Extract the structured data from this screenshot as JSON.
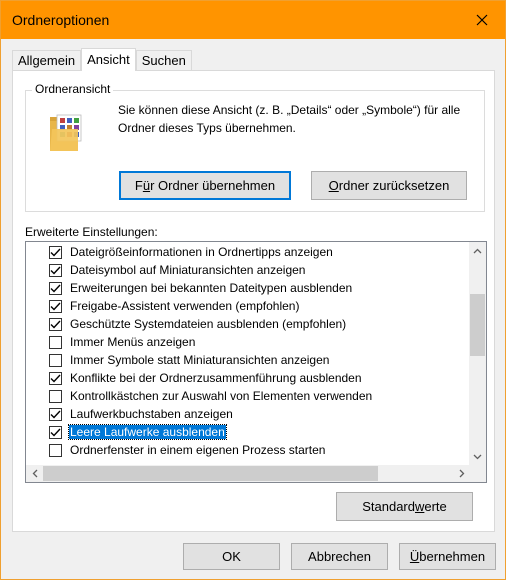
{
  "window": {
    "title": "Ordneroptionen"
  },
  "tabs": [
    {
      "label": "Allgemein",
      "active": false
    },
    {
      "label": "Ansicht",
      "active": true
    },
    {
      "label": "Suchen",
      "active": false
    }
  ],
  "folder_view": {
    "legend": "Ordneransicht",
    "description": "Sie können diese Ansicht (z. B. „Details“ oder „Symbole“) für alle Ordner dieses Typs übernehmen.",
    "apply_button": {
      "pre": "F",
      "key": "ü",
      "post": "r Ordner übernehmen"
    },
    "reset_button": {
      "pre": "",
      "key": "O",
      "post": "rdner zurücksetzen"
    }
  },
  "advanced": {
    "label": "Erweiterte Einstellungen:",
    "items": [
      {
        "label": "Dateigrößeinformationen in Ordnertipps anzeigen",
        "checked": true,
        "selected": false
      },
      {
        "label": "Dateisymbol auf Miniaturansichten anzeigen",
        "checked": true,
        "selected": false
      },
      {
        "label": "Erweiterungen bei bekannten Dateitypen ausblenden",
        "checked": true,
        "selected": false
      },
      {
        "label": "Freigabe-Assistent verwenden (empfohlen)",
        "checked": true,
        "selected": false
      },
      {
        "label": "Geschützte Systemdateien ausblenden (empfohlen)",
        "checked": true,
        "selected": false
      },
      {
        "label": "Immer Menüs anzeigen",
        "checked": false,
        "selected": false
      },
      {
        "label": "Immer Symbole statt Miniaturansichten anzeigen",
        "checked": false,
        "selected": false
      },
      {
        "label": "Konflikte bei der Ordnerzusammenführung ausblenden",
        "checked": true,
        "selected": false
      },
      {
        "label": "Kontrollkästchen zur Auswahl von Elementen verwenden",
        "checked": false,
        "selected": false
      },
      {
        "label": "Laufwerkbuchstaben anzeigen",
        "checked": true,
        "selected": false
      },
      {
        "label": "Leere Laufwerke ausblenden",
        "checked": true,
        "selected": true
      },
      {
        "label": "Ordnerfenster in einem eigenen Prozess starten",
        "checked": false,
        "selected": false
      }
    ],
    "restore_button": {
      "pre": "Standard",
      "key": "w",
      "post": "erte"
    }
  },
  "footer": {
    "ok": "OK",
    "cancel": "Abbrechen",
    "apply": {
      "pre": "",
      "key": "Ü",
      "post": "bernehmen"
    }
  },
  "colors": {
    "titlebar": "#ff9400",
    "accent": "#0078d7"
  },
  "icons": {
    "close": "close-icon",
    "folder": "folder-icon",
    "check": "check-icon"
  }
}
